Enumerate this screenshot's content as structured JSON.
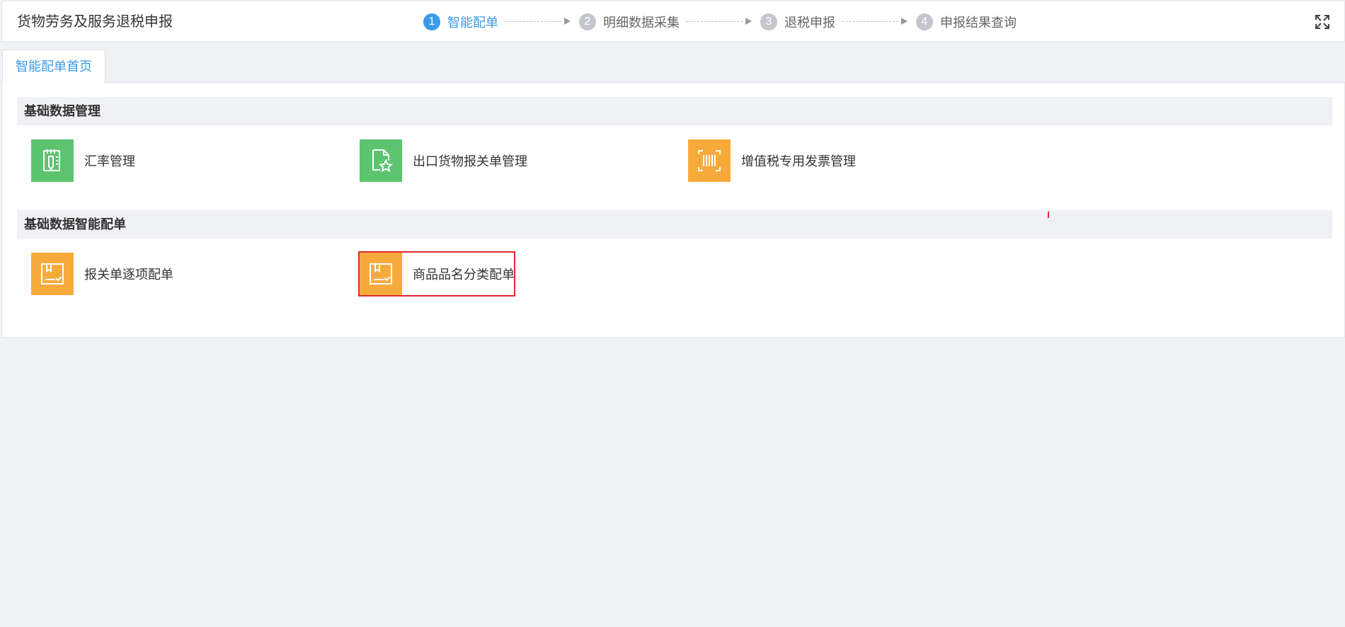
{
  "header": {
    "title": "货物劳务及服务退税申报",
    "steps": [
      {
        "num": "1",
        "label": "智能配单",
        "active": true
      },
      {
        "num": "2",
        "label": "明细数据采集",
        "active": false
      },
      {
        "num": "3",
        "label": "退税申报",
        "active": false
      },
      {
        "num": "4",
        "label": "申报结果查询",
        "active": false
      }
    ],
    "fullscreen_icon": "expand-icon"
  },
  "tabs": [
    {
      "label": "智能配单首页",
      "active": true
    }
  ],
  "sections": [
    {
      "title": "基础数据管理",
      "items": [
        {
          "label": "汇率管理",
          "icon": "document-pen-icon",
          "color": "#5cc46e"
        },
        {
          "label": "出口货物报关单管理",
          "icon": "document-star-icon",
          "color": "#5cc46e"
        },
        {
          "label": "增值税专用发票管理",
          "icon": "barcode-icon",
          "color": "#f7aa3c"
        }
      ]
    },
    {
      "title": "基础数据智能配单",
      "items": [
        {
          "label": "报关单逐项配单",
          "icon": "package-check-icon",
          "color": "#f7aa3c"
        },
        {
          "label": "商品品名分类配单",
          "icon": "package-check-icon",
          "color": "#f7aa3c",
          "selected": true
        }
      ]
    }
  ],
  "colors": {
    "accent": "#3a9ae8",
    "green": "#5cc46e",
    "orange": "#f7aa3c",
    "highlight": "#e0292e"
  }
}
